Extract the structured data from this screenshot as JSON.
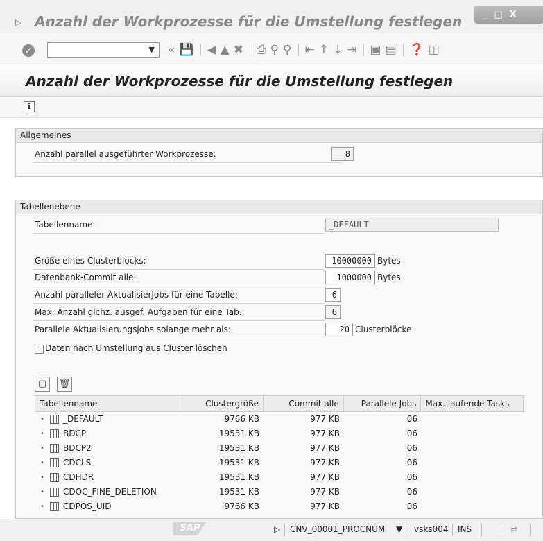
{
  "window": {
    "title": "Anzahl der Workprozesse für die Umstellung festlegen",
    "controls": [
      "_",
      "□",
      "X"
    ]
  },
  "toolbar": {
    "command_value": "",
    "icons": [
      "enter-icon",
      "save-icon",
      "back-icon",
      "exit-icon",
      "cancel-icon",
      "print-icon",
      "find-icon",
      "find-next-icon",
      "first-page-icon",
      "previous-page-icon",
      "next-page-icon",
      "last-page-icon",
      "new-session-icon",
      "shortcut-icon",
      "help-icon",
      "customize-icon"
    ]
  },
  "page": {
    "title": "Anzahl der Workprozesse für die Umstellung festlegen"
  },
  "general": {
    "heading": "Allgemeines",
    "workprocess_label": "Anzahl parallel ausgeführter Workprozesse:",
    "workprocess_value": "8"
  },
  "table_level": {
    "heading": "Tabellenebene",
    "tablename_label": "Tabellenname:",
    "tablename_value": "_DEFAULT",
    "clustersize_label": "Größe eines Clusterblocks:",
    "clustersize_value": "10000000",
    "clustersize_unit": "Bytes",
    "commit_label": "Datenbank-Commit alle:",
    "commit_value": "1000000",
    "commit_unit": "Bytes",
    "jobs_label": "Anzahl paralleler AktualisierJobs für eine Tabelle:",
    "jobs_value": "6",
    "maxtasks_label": "Max. Anzahl glchz. ausgef. Aufgaben für eine Tab.:",
    "maxtasks_value": "6",
    "parallel_label": "Parallele Aktualisierungsjobs solange mehr als:",
    "parallel_value": "20",
    "parallel_unit": "Clusterblöcke",
    "delete_checkbox_label": "Daten nach Umstellung aus Cluster löschen",
    "delete_checked": false
  },
  "grid": {
    "columns": [
      "Tabellenname",
      "Clustergröße",
      "Commit alle",
      "Parallele Jobs",
      "Max. laufende Tasks"
    ],
    "rows": [
      {
        "name": "_DEFAULT",
        "size": "9766 KB",
        "commit": "977 KB",
        "jobs": "06",
        "tasks": ""
      },
      {
        "name": "BDCP",
        "size": "19531 KB",
        "commit": "977 KB",
        "jobs": "06",
        "tasks": ""
      },
      {
        "name": "BDCP2",
        "size": "19531 KB",
        "commit": "977 KB",
        "jobs": "06",
        "tasks": ""
      },
      {
        "name": "CDCLS",
        "size": "19531 KB",
        "commit": "977 KB",
        "jobs": "06",
        "tasks": ""
      },
      {
        "name": "CDHDR",
        "size": "19531 KB",
        "commit": "977 KB",
        "jobs": "06",
        "tasks": ""
      },
      {
        "name": "CDOC_FINE_DELETION",
        "size": "19531 KB",
        "commit": "977 KB",
        "jobs": "06",
        "tasks": ""
      },
      {
        "name": "CDPOS_UID",
        "size": "9766 KB",
        "commit": "977 KB",
        "jobs": "06",
        "tasks": ""
      }
    ]
  },
  "statusbar": {
    "logo": "SAP",
    "program": "CNV_00001_PROCNUM",
    "server": "vsks004",
    "mode": "INS"
  }
}
